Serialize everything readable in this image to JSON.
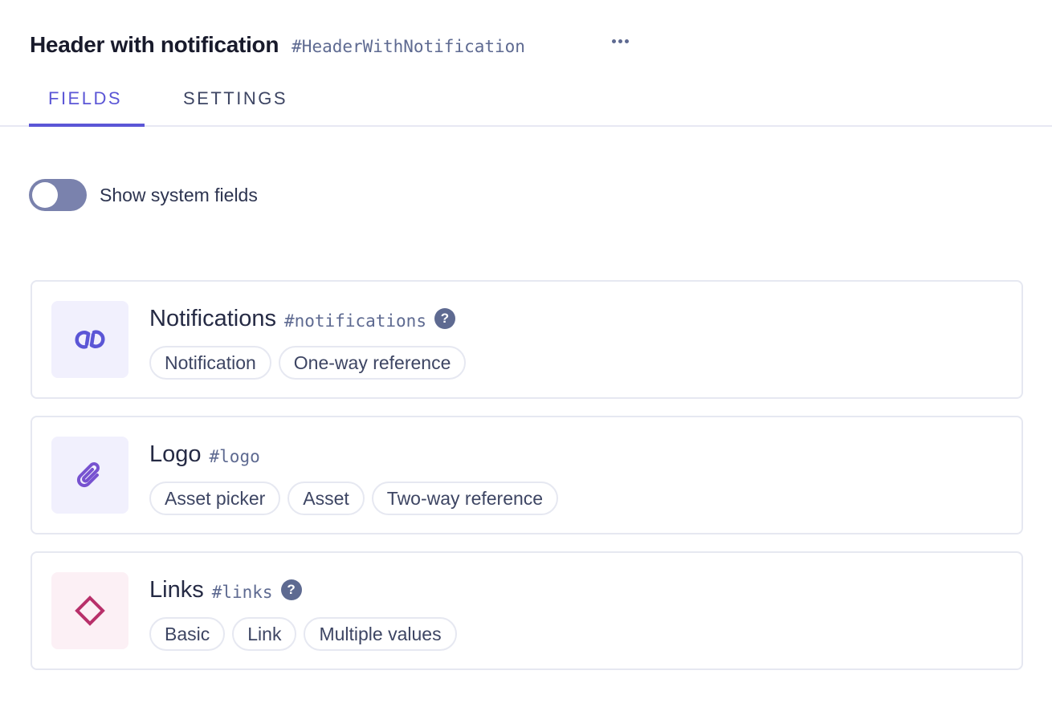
{
  "header": {
    "title": "Header with notification",
    "api_id": "#HeaderWithNotification",
    "more_icon": "more-horizontal-icon"
  },
  "tabs": [
    {
      "label": "FIELDS",
      "active": true
    },
    {
      "label": "SETTINGS",
      "active": false
    }
  ],
  "colors": {
    "accent": "#5b56d6",
    "muted": "#5e6a91",
    "toggle_off": "#7a82ad",
    "reference_icon": "#5b56d6",
    "asset_icon": "#7752d0",
    "link_icon": "#b8306a"
  },
  "toggle": {
    "label": "Show system fields",
    "checked": false
  },
  "fields": [
    {
      "name": "Notifications",
      "api_id": "#notifications",
      "icon": "reference-link-icon",
      "has_help": true,
      "help_label": "?",
      "chips": [
        "Notification",
        "One-way reference"
      ]
    },
    {
      "name": "Logo",
      "api_id": "#logo",
      "icon": "paperclip-icon",
      "has_help": false,
      "chips": [
        "Asset picker",
        "Asset",
        "Two-way reference"
      ]
    },
    {
      "name": "Links",
      "api_id": "#links",
      "icon": "diamond-icon",
      "has_help": true,
      "help_label": "?",
      "chips": [
        "Basic",
        "Link",
        "Multiple values"
      ]
    }
  ]
}
